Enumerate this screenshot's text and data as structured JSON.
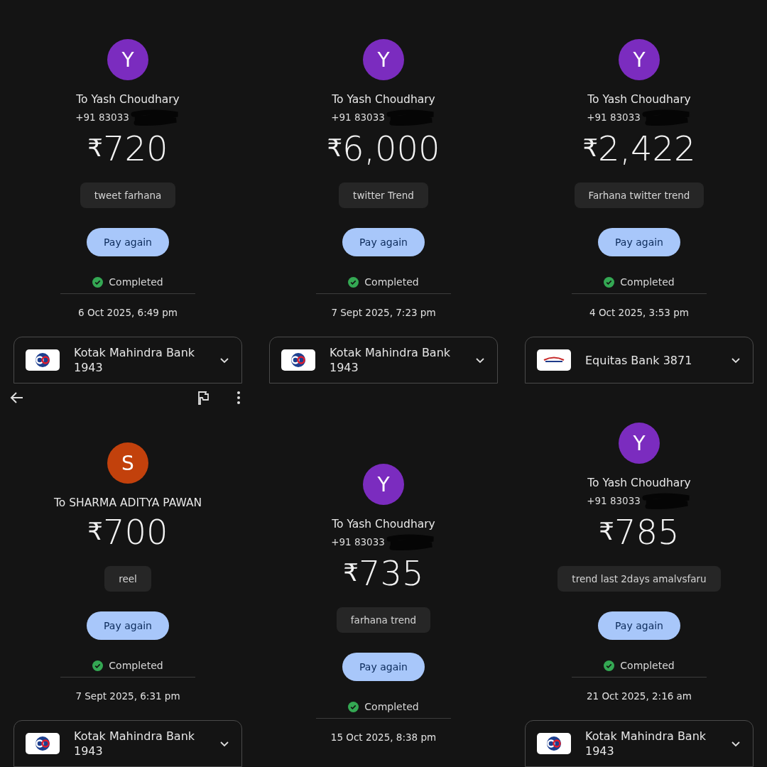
{
  "panels": [
    {
      "avatar": {
        "letter": "Y",
        "color": "#7b2cbf"
      },
      "recipient": "To Yash Choudhary",
      "phone": {
        "text": "+91 83033",
        "redacted": true
      },
      "currency": "₹",
      "amount": "720",
      "memo": "tweet farhana",
      "button": "Pay again",
      "status": "Completed",
      "date": "6 Oct 2025, 6:49 pm",
      "bank": {
        "kind": "kotak",
        "name": "Kotak Mahindra Bank",
        "account": "1943"
      }
    },
    {
      "avatar": {
        "letter": "Y",
        "color": "#7b2cbf"
      },
      "recipient": "To Yash Choudhary",
      "phone": {
        "text": "+91 83033",
        "redacted": true
      },
      "currency": "₹",
      "amount": "6,000",
      "memo": "twitter Trend",
      "button": "Pay again",
      "status": "Completed",
      "date": "7 Sept 2025, 7:23 pm",
      "bank": {
        "kind": "kotak",
        "name": "Kotak Mahindra Bank",
        "account": "1943"
      }
    },
    {
      "avatar": {
        "letter": "Y",
        "color": "#7b2cbf"
      },
      "recipient": "To Yash Choudhary",
      "phone": {
        "text": "+91 83033",
        "redacted": true
      },
      "currency": "₹",
      "amount": "2,422",
      "memo": "Farhana twitter trend",
      "button": "Pay again",
      "status": "Completed",
      "date": "4 Oct 2025, 3:53 pm",
      "bank": {
        "kind": "equitas",
        "name": "Equitas Bank 3871"
      }
    },
    {
      "toolbar": {
        "kind": "actions"
      },
      "avatar": {
        "letter": "S",
        "color": "#c2410c"
      },
      "recipient": "To SHARMA ADITYA PAWAN",
      "currency": "₹",
      "amount": "700",
      "memo": "reel",
      "button": "Pay again",
      "status": "Completed",
      "date": "7 Sept 2025, 6:31 pm",
      "bank": {
        "kind": "kotak",
        "name": "Kotak Mahindra Bank",
        "account": "1943"
      }
    },
    {
      "avatar": {
        "letter": "Y",
        "color": "#7b2cbf"
      },
      "recipient": "To Yash Choudhary",
      "phone": {
        "text": "+91 83033",
        "redacted": true
      },
      "currency": "₹",
      "amount": "735",
      "memo": "farhana trend",
      "button": "Pay again",
      "status": "Completed",
      "date": "15 Oct 2025, 8:38 pm"
    },
    {
      "avatar": {
        "letter": "Y",
        "color": "#7b2cbf"
      },
      "recipient": "To Yash Choudhary",
      "phone": {
        "text": "+91 83033",
        "redacted": true
      },
      "currency": "₹",
      "amount": "785",
      "memo": "trend last 2days amalvsfaru",
      "button": "Pay again",
      "status": "Completed",
      "date": "21 Oct 2025, 2:16 am",
      "bank": {
        "kind": "kotak",
        "name": "Kotak Mahindra Bank",
        "account": "1943"
      }
    }
  ]
}
